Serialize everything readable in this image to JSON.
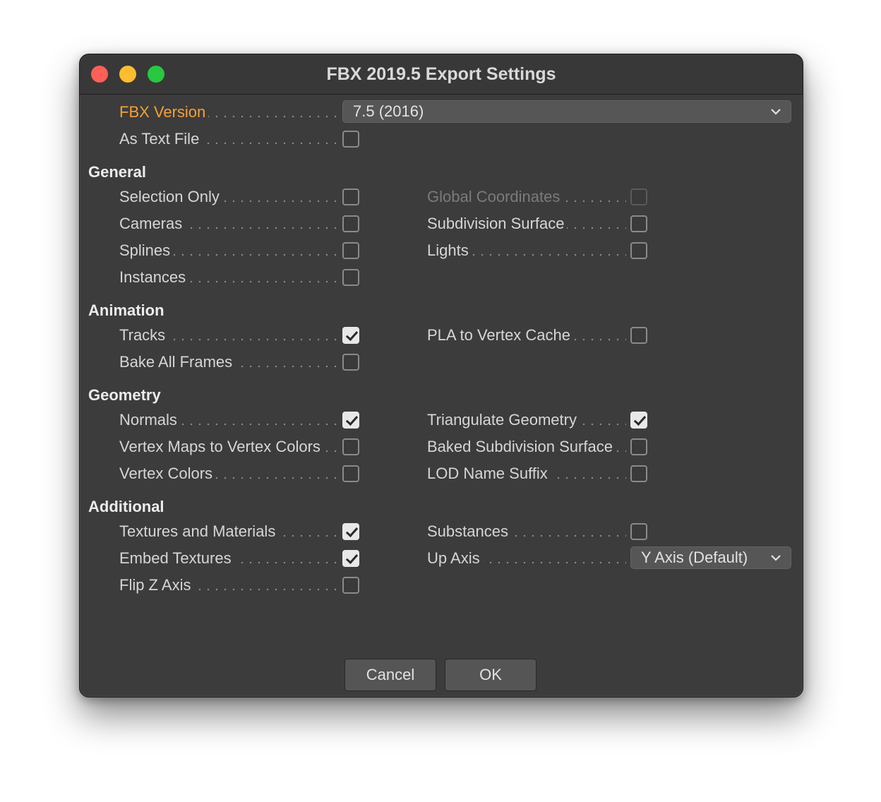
{
  "window": {
    "title": "FBX 2019.5 Export Settings"
  },
  "top": {
    "fbx_version": {
      "label": "FBX Version",
      "value": "7.5 (2016)"
    },
    "as_text_file": {
      "label": "As Text File",
      "checked": false
    }
  },
  "sections": {
    "general": "General",
    "animation": "Animation",
    "geometry": "Geometry",
    "additional": "Additional"
  },
  "general": {
    "selection_only": {
      "label": "Selection Only",
      "checked": false
    },
    "cameras": {
      "label": "Cameras",
      "checked": false
    },
    "splines": {
      "label": "Splines",
      "checked": false
    },
    "instances": {
      "label": "Instances",
      "checked": false
    },
    "global_coordinates": {
      "label": "Global Coordinates",
      "checked": false,
      "disabled": true
    },
    "subdivision_surface": {
      "label": "Subdivision Surface",
      "checked": false
    },
    "lights": {
      "label": "Lights",
      "checked": false
    }
  },
  "animation": {
    "tracks": {
      "label": "Tracks",
      "checked": true
    },
    "bake_all_frames": {
      "label": "Bake All Frames",
      "checked": false
    },
    "pla_to_vertex_cache": {
      "label": "PLA to Vertex Cache",
      "checked": false
    }
  },
  "geometry": {
    "normals": {
      "label": "Normals",
      "checked": true
    },
    "vertex_maps": {
      "label": "Vertex Maps to Vertex Colors",
      "checked": false
    },
    "vertex_colors": {
      "label": "Vertex Colors",
      "checked": false
    },
    "triangulate": {
      "label": "Triangulate Geometry",
      "checked": true
    },
    "baked_subdivision": {
      "label": "Baked Subdivision Surface",
      "checked": false
    },
    "lod_name_suffix": {
      "label": "LOD Name Suffix",
      "checked": false
    }
  },
  "additional": {
    "textures_materials": {
      "label": "Textures and Materials",
      "checked": true
    },
    "embed_textures": {
      "label": "Embed Textures",
      "checked": true
    },
    "flip_z_axis": {
      "label": "Flip Z Axis",
      "checked": false
    },
    "substances": {
      "label": "Substances",
      "checked": false
    },
    "up_axis": {
      "label": "Up Axis",
      "value": "Y Axis (Default)"
    }
  },
  "buttons": {
    "cancel": "Cancel",
    "ok": "OK"
  },
  "colors": {
    "accent": "#f7a035",
    "background": "#3c3c3c"
  }
}
